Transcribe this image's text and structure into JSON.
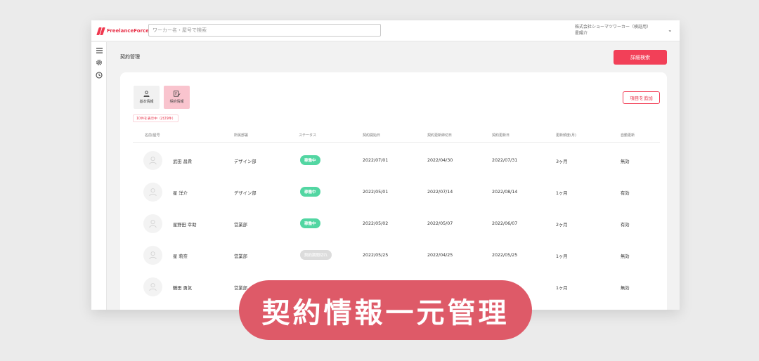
{
  "header": {
    "logo_text": "FreelanceForce",
    "search_placeholder": "ワーカー名・屋号で検索",
    "company_name": "株式会社ショーマツワーカー（検証用）",
    "user_name": "星陽介"
  },
  "sidebar": {
    "items": [
      "menu-icon",
      "gear-icon",
      "clock-icon"
    ]
  },
  "page": {
    "title": "契約管理",
    "detail_search_label": "詳細検索"
  },
  "panel": {
    "tabs": [
      {
        "label": "基本情報",
        "icon": "person-icon",
        "active": false
      },
      {
        "label": "契約情報",
        "icon": "contract-edit-icon",
        "active": true
      }
    ],
    "count_text": "10件を表示中（計29件）",
    "add_item_label": "項目を追加"
  },
  "table": {
    "headers": [
      "名前/屋号",
      "所属部署",
      "ステータス",
      "契約開始日",
      "契約更新締切日",
      "契約更新日",
      "更新頻度(月)",
      "自動更新"
    ],
    "rows": [
      {
        "name": "武田 昌貴",
        "department": "デザイン部",
        "status": "稼働中",
        "status_kind": "active",
        "start": "2022/07/01",
        "deadline": "2022/04/30",
        "renewal": "2022/07/31",
        "frequency": "3ヶ月",
        "auto_renew": "無効"
      },
      {
        "name": "星 洋介",
        "department": "デザイン部",
        "status": "稼働中",
        "status_kind": "active",
        "start": "2022/05/01",
        "deadline": "2022/07/14",
        "renewal": "2022/08/14",
        "frequency": "1ヶ月",
        "auto_renew": "有効"
      },
      {
        "name": "星野田 幸助",
        "department": "営業部",
        "status": "稼働中",
        "status_kind": "active",
        "start": "2022/05/02",
        "deadline": "2022/05/07",
        "renewal": "2022/06/07",
        "frequency": "2ヶ月",
        "auto_renew": "有効"
      },
      {
        "name": "星 莉奈",
        "department": "営業部",
        "status": "契約期間切れ",
        "status_kind": "expired",
        "start": "2022/05/25",
        "deadline": "2022/04/25",
        "renewal": "2022/05/25",
        "frequency": "1ヶ月",
        "auto_renew": "無効"
      },
      {
        "name": "鶴田 勇気",
        "department": "営業部",
        "status": "",
        "status_kind": "",
        "start": "",
        "deadline": "",
        "renewal": "",
        "frequency": "1ヶ月",
        "auto_renew": "無効"
      }
    ]
  },
  "banner": {
    "text": "契約情報一元管理"
  },
  "colors": {
    "accent": "#f24058",
    "active_status": "#52d6a2",
    "banner": "#de5a68"
  }
}
